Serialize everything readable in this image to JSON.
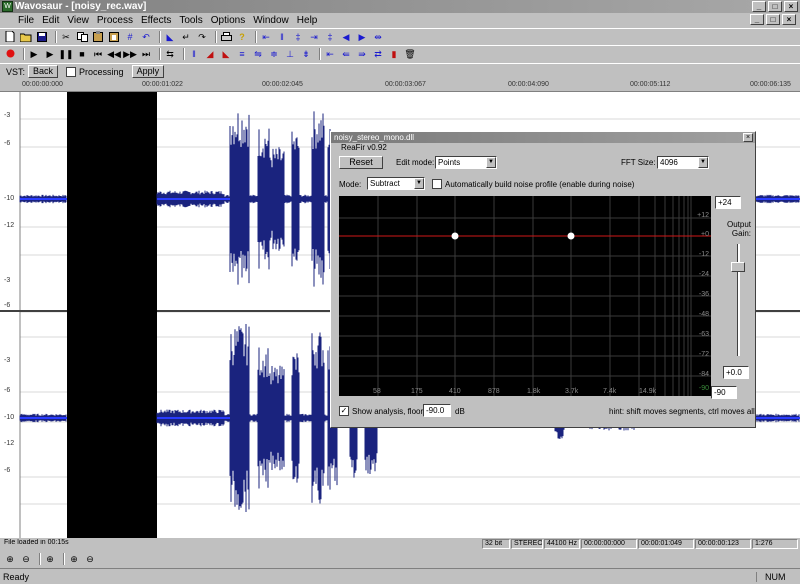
{
  "window": {
    "title": "Wavosaur - [noisy_rec.wav]",
    "app_icon": "W",
    "min": "_",
    "max": "□",
    "close": "×"
  },
  "menu": [
    "File",
    "Edit",
    "View",
    "Process",
    "Effects",
    "Tools",
    "Options",
    "Window",
    "Help"
  ],
  "vst": {
    "label": "VST:",
    "back": "Back",
    "processing": "Processing",
    "apply": "Apply"
  },
  "ruler": {
    "times": [
      "00:00:00:000",
      "00:00:01:022",
      "00:00:02:045",
      "00:00:03:067",
      "00:00:04:090",
      "00:00:05:112",
      "00:00:06:135"
    ]
  },
  "db_labels": [
    "-3",
    "-6",
    "-10",
    "-12",
    "-3",
    "-6",
    "-3",
    "-6",
    "-10",
    "-12",
    "-6"
  ],
  "dialog": {
    "title": "noisy_stereo_mono.dll",
    "subtitle": "ReaFir v0.92",
    "reset": "Reset",
    "edit_mode_label": "Edit mode:",
    "edit_mode_value": "Points",
    "fft_label": "FFT Size:",
    "fft_value": "4096",
    "mode_label": "Mode:",
    "mode_value": "Subtract",
    "auto_label": "Automatically build noise profile (enable during noise)",
    "output_gain_label": "Output Gain:",
    "gain_top": "+24",
    "gain_value": "+0.0",
    "gain_bottom": "-90",
    "show_analysis_label": "Show analysis, floor:",
    "floor_value": "-90.0",
    "db_unit": "dB",
    "hint": "hint: shift moves segments, ctrl moves all",
    "plot_ylabels": [
      "+12",
      "+0",
      "-12",
      "-24",
      "-36",
      "-48",
      "-63",
      "-72",
      "-84",
      "-90"
    ],
    "plot_xlabels": [
      "58",
      "175",
      "410",
      "878",
      "1.8k",
      "3.7k",
      "7.4k",
      "14.9k"
    ]
  },
  "status": {
    "message": "File loaded in 00:15s",
    "bits": "32 bit",
    "channels": "STEREO",
    "rate": "44100 Hz",
    "pos1": "00:00:00:000",
    "pos2": "00:00:01:049",
    "pos3": "00:00:00:123",
    "zoom": "1:276"
  },
  "bottom": {
    "ready": "Ready",
    "num": "NUM"
  }
}
